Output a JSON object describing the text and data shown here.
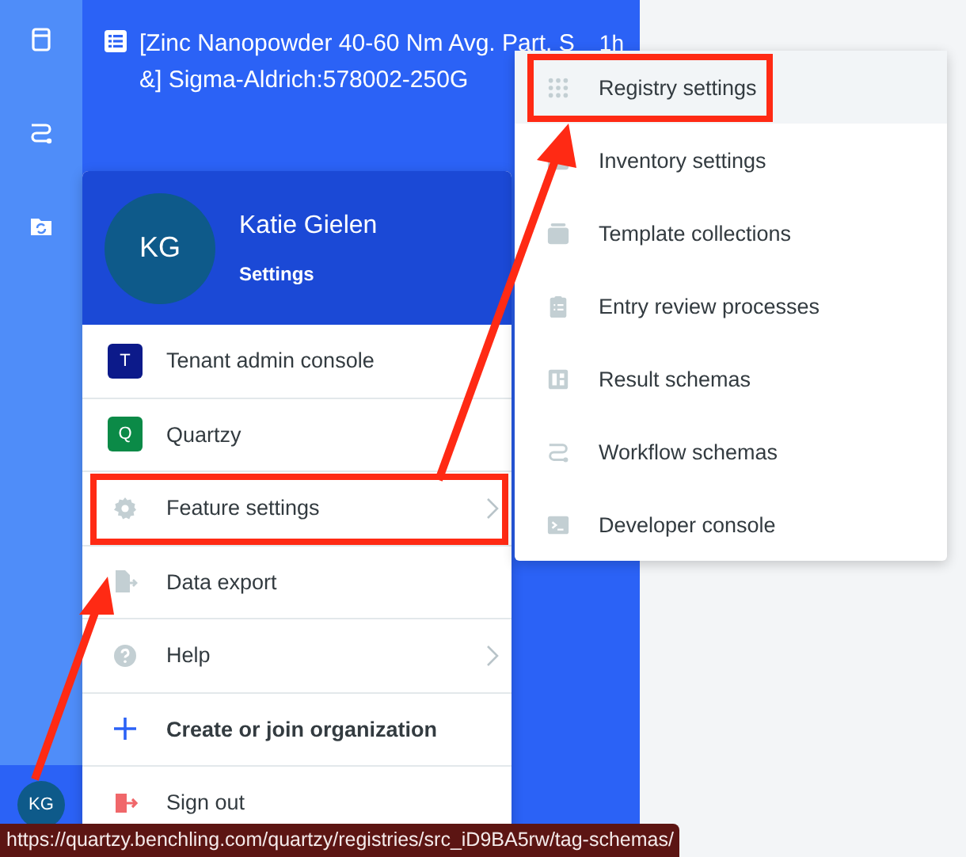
{
  "rail": {
    "avatar": "KG"
  },
  "recent_item": {
    "lines": [
      "[Zinc Nanopowder 40-60 Nm Avg. Part. S",
      "&] Sigma-Aldrich:578002-250G"
    ],
    "time": "1h"
  },
  "profile": {
    "initials": "KG",
    "name": "Katie Gielen",
    "link": "Settings"
  },
  "menu": [
    {
      "kind": "badge",
      "badge": "T",
      "color": "#0c1a8a",
      "label": "Tenant admin console",
      "has_submenu": false,
      "annotated": false
    },
    {
      "kind": "badge",
      "badge": "Q",
      "color": "#0b8a47",
      "label": "Quartzy",
      "has_submenu": false,
      "annotated": false
    },
    {
      "kind": "icon",
      "label": "Feature settings",
      "has_submenu": true,
      "annotated": true
    },
    {
      "kind": "icon",
      "label": "Data export",
      "has_submenu": false,
      "annotated": false
    },
    {
      "kind": "icon",
      "label": "Help",
      "has_submenu": true,
      "annotated": false
    },
    {
      "kind": "action",
      "label": "Create or join organization",
      "has_submenu": false,
      "annotated": false
    },
    {
      "kind": "danger",
      "label": "Sign out",
      "has_submenu": false,
      "annotated": false
    }
  ],
  "submenu": [
    {
      "label": "Registry settings",
      "selected": true,
      "annotated": true
    },
    {
      "label": "Inventory settings",
      "selected": false,
      "annotated": false
    },
    {
      "label": "Template collections",
      "selected": false,
      "annotated": false
    },
    {
      "label": "Entry review processes",
      "selected": false,
      "annotated": false
    },
    {
      "label": "Result schemas",
      "selected": false,
      "annotated": false
    },
    {
      "label": "Workflow schemas",
      "selected": false,
      "annotated": false
    },
    {
      "label": "Developer console",
      "selected": false,
      "annotated": false
    }
  ],
  "status_bar": "https://quartzy.benchling.com/quartzy/registries/src_iD9BA5rw/tag-schemas/"
}
